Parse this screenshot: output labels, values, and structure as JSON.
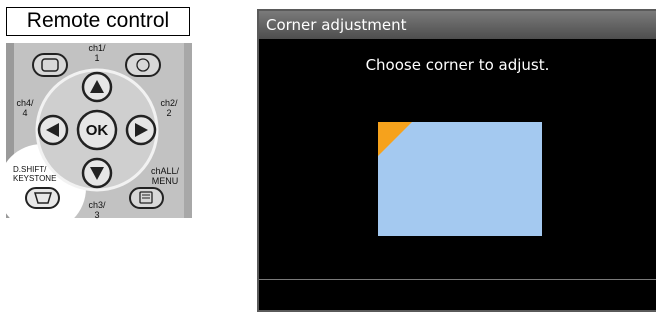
{
  "remote": {
    "title": "Remote control",
    "labels": {
      "ch1": "ch1/\n1",
      "ch4": "ch4/\n4",
      "ch2": "ch2/\n2",
      "ok": "OK",
      "dshift": "D.SHIFT/\nKEYSTONE",
      "chall": "chALL/\nMENU",
      "ch3": "ch3/\n3"
    }
  },
  "screen": {
    "header": "Corner adjustment",
    "instruction": "Choose corner to adjust.",
    "colors": {
      "preview": "#a4c9f0",
      "marker": "#f6a21c"
    },
    "selected_corner": "top-left"
  }
}
